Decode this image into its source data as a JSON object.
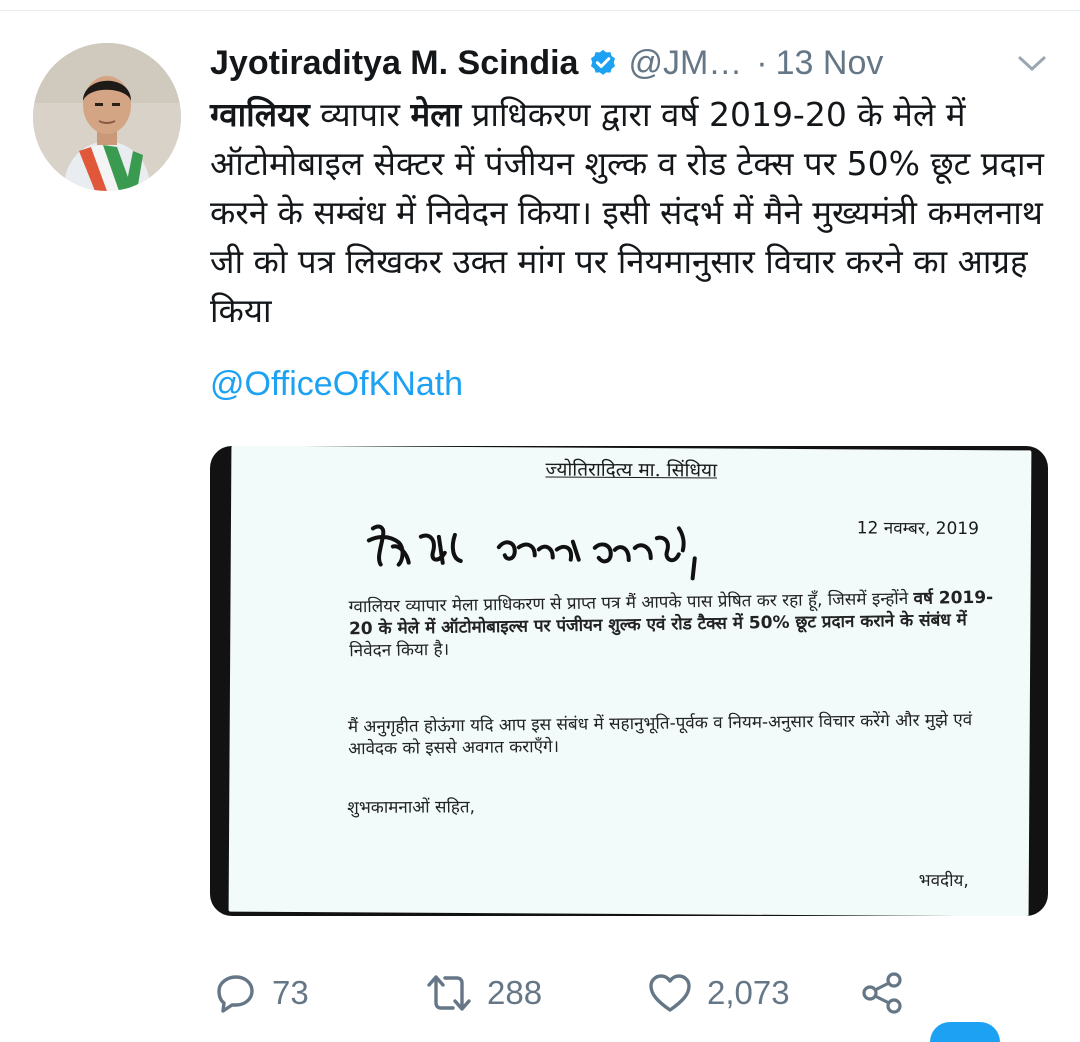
{
  "tweet": {
    "author": {
      "display_name": "Jyotiraditya M. Scindia",
      "handle": "@JM…",
      "verified": true
    },
    "separator": "·",
    "timestamp": "13 Nov",
    "text": {
      "bold_1": "ग्वालियर",
      "plain_1": " व्यापार ",
      "bold_2": "मेला",
      "plain_2": " प्राधिकरण द्वारा वर्ष 2019-20 के मेले में ऑटोमोबाइल सेक्टर में पंजीयन शुल्क व रोड टेक्स पर 50% छूट प्रदान  करने के सम्बंध में निवेदन किया। इसी संदर्भ में मैने मुख्यमंत्री कमलनाथ जी को पत्र लिखकर उक्त मांग पर नियमानुसार विचार करने का आग्रह किया"
    },
    "mention": "@OfficeOfKNath"
  },
  "letter": {
    "letterhead": "ज्योतिरादित्य मा. सिंधिया",
    "date": "12 नवम्बर, 2019",
    "para1_a": "ग्वालियर व्यापार मेला प्राधिकरण से प्राप्त पत्र मैं आपके पास प्रेषित कर रहा हूँ, जिसमें इन्होंने ",
    "para1_b": "वर्ष 2019-20 के मेले में ऑटोमोबाइल्स पर पंजीयन शुल्क एवं रोड टैक्स में 50% छूट प्रदान कराने के संबंध में",
    "para1_c": " निवेदन किया है।",
    "para2": "मैं अनुगृहीत होऊंगा यदि आप इस संबंध में सहानुभूति-पूर्वक व नियम-अनुसार विचार करेंगे और मुझे एवं आवेदक को इससे अवगत कराएँगे।",
    "closing": "शुभकामनाओं सहित,",
    "signoff": "भवदीय,"
  },
  "actions": {
    "reply_count": "73",
    "retweet_count": "288",
    "like_count": "2,073"
  },
  "colors": {
    "link": "#1da1f2",
    "verified": "#1da1f2",
    "secondary_text": "#657786",
    "primary_text": "#14171a"
  },
  "icons": [
    "verified-badge-icon",
    "chevron-down-icon",
    "reply-icon",
    "retweet-icon",
    "like-icon",
    "share-icon"
  ]
}
